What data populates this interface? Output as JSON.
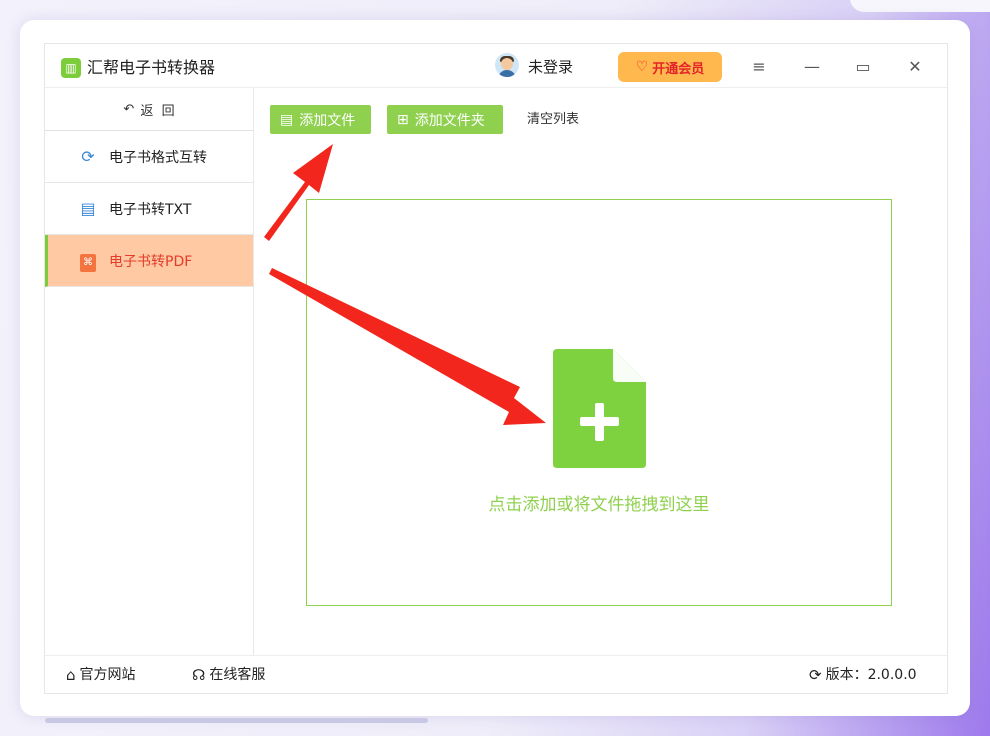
{
  "app": {
    "title": "汇帮电子书转换器",
    "logo_glyph": "▥",
    "accent_color": "#8fd14f",
    "active_color": "#ffc9a3"
  },
  "header": {
    "login_label": "未登录",
    "vip_label": "开通会员",
    "menu_icon": "≡",
    "minimize_icon": "—",
    "maximize_icon": "▭",
    "close_icon": "✕"
  },
  "sidebar": {
    "back_label": "返  回",
    "items": [
      {
        "label": "电子书格式互转",
        "icon": "refresh-icon"
      },
      {
        "label": "电子书转TXT",
        "icon": "document-icon"
      },
      {
        "label": "电子书转PDF",
        "icon": "pdf-icon",
        "active": true
      }
    ]
  },
  "toolbar": {
    "add_file_label": "添加文件",
    "add_folder_label": "添加文件夹",
    "clear_label": "清空列表"
  },
  "dropzone": {
    "hint": "点击添加或将文件拖拽到这里"
  },
  "footer": {
    "website_label": "官方网站",
    "support_label": "在线客服",
    "version_label": "版本：2.0.0.0"
  }
}
